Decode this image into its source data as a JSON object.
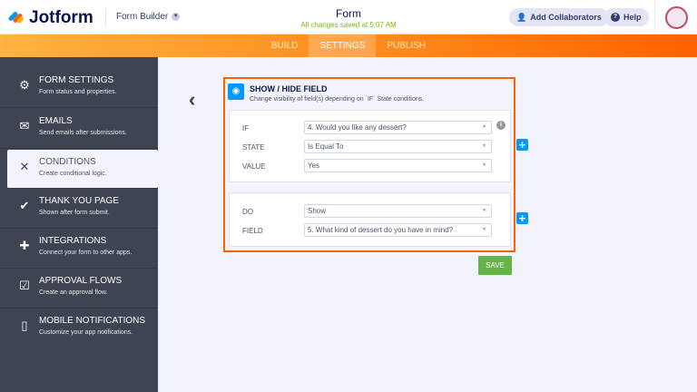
{
  "header": {
    "brand": "Jotform",
    "builder": "Form Builder",
    "title": "Form",
    "saved": "All changes saved at 5:07 AM",
    "collab": "Add Collaborators",
    "help": "Help"
  },
  "nav": {
    "tabs": [
      "BUILD",
      "SETTINGS",
      "PUBLISH"
    ],
    "active": "SETTINGS"
  },
  "sidebar": [
    {
      "title": "FORM SETTINGS",
      "sub": "Form status and properties.",
      "icon": "gear-icon"
    },
    {
      "title": "EMAILS",
      "sub": "Send emails after submissions.",
      "icon": "envelope-icon"
    },
    {
      "title": "CONDITIONS",
      "sub": "Create conditional logic.",
      "icon": "shuffle-icon"
    },
    {
      "title": "THANK YOU PAGE",
      "sub": "Shown after form submit.",
      "icon": "check-circle-icon"
    },
    {
      "title": "INTEGRATIONS",
      "sub": "Connect your form to other apps.",
      "icon": "puzzle-icon"
    },
    {
      "title": "APPROVAL FLOWS",
      "sub": "Create an approval flow.",
      "icon": "approval-icon"
    },
    {
      "title": "MOBILE NOTIFICATIONS",
      "sub": "Customize your app notifications.",
      "icon": "mobile-icon"
    }
  ],
  "panel": {
    "title": "SHOW / HIDE FIELD",
    "subtitle": "Change visibility of field(s) depending on `IF` State conditions.",
    "if_label": "IF",
    "if_value": "4. Would you like any dessert?",
    "state_label": "STATE",
    "state_value": "Is Equal To",
    "value_label": "VALUE",
    "value_value": "Yes",
    "do_label": "DO",
    "do_value": "Show",
    "field_label": "FIELD",
    "field_value": "5. What kind of dessert do you have in mind?",
    "save": "SAVE"
  },
  "colors": {
    "accent": "#ff6100",
    "blue": "#0099ff",
    "save": "#64b448",
    "sidebar": "#3e4451"
  }
}
